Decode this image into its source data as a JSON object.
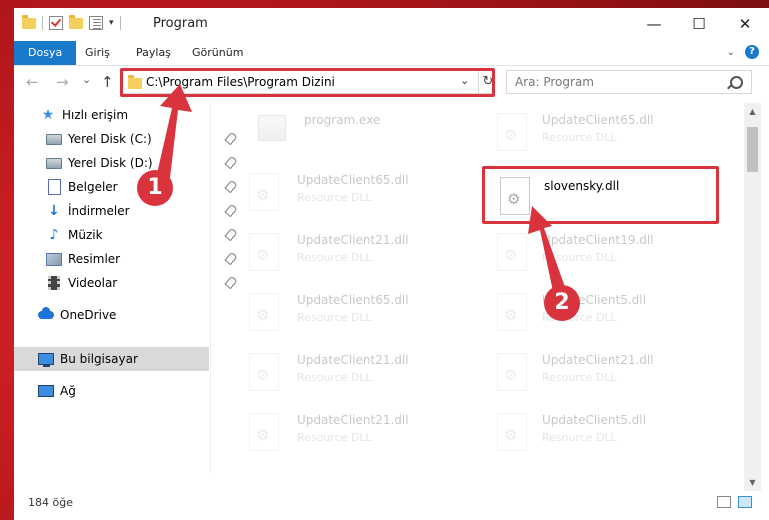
{
  "window": {
    "title": "Program",
    "minimize_glyph": "—",
    "maximize_glyph": "☐",
    "close_glyph": "✕"
  },
  "ribbon": {
    "tabs": [
      {
        "label": "Dosya"
      },
      {
        "label": "Giriş"
      },
      {
        "label": "Paylaş"
      },
      {
        "label": "Görünüm"
      }
    ]
  },
  "nav": {
    "address": "C:\\Program Files\\Program Dizini",
    "search_placeholder": "Ara: Program",
    "back_glyph": "←",
    "forward_glyph": "→",
    "recent_glyph": "⌄",
    "up_glyph": "↑",
    "refresh_glyph": "↻"
  },
  "sidebar": {
    "items": [
      {
        "label": "Hızlı erişim",
        "icon": "star-icon"
      },
      {
        "label": "Yerel Disk (C:)",
        "icon": "drive-icon"
      },
      {
        "label": "Yerel Disk (D:)",
        "icon": "drive-icon"
      },
      {
        "label": "Belgeler",
        "icon": "documents-icon"
      },
      {
        "label": "İndirmeler",
        "icon": "downloads-icon"
      },
      {
        "label": "Müzik",
        "icon": "music-icon"
      },
      {
        "label": "Resimler",
        "icon": "pictures-icon"
      },
      {
        "label": "Videolar",
        "icon": "videos-icon"
      },
      {
        "label": "OneDrive",
        "icon": "cloud-icon"
      },
      {
        "label": "Bu bilgisayar",
        "icon": "computer-icon"
      },
      {
        "label": "Ağ",
        "icon": "network-icon"
      }
    ]
  },
  "files": [
    {
      "name": "program.exe",
      "type": ""
    },
    {
      "name": "UpdateClient65.dll",
      "type": "Resource DLL"
    },
    {
      "name": "UpdateClient65.dll",
      "type": "Resource DLL"
    },
    {
      "name": "slovensky.dll",
      "type": ""
    },
    {
      "name": "UpdateClient21.dll",
      "type": "Resource DLL"
    },
    {
      "name": "UpdateClient19.dll",
      "type": "Resource DLL"
    },
    {
      "name": "UpdateClient65.dll",
      "type": "Resource DLL"
    },
    {
      "name": "UpdateClient5.dll",
      "type": "Resource DLL"
    },
    {
      "name": "UpdateClient21.dll",
      "type": "Resource DLL"
    },
    {
      "name": "UpdateClient21.dll",
      "type": "Resource DLL"
    },
    {
      "name": "UpdateClient21.dll",
      "type": "Resource DLL"
    },
    {
      "name": "UpdateClient5.dll",
      "type": "Resource DLL"
    }
  ],
  "status": {
    "item_count": "184 öğe"
  },
  "markers": [
    {
      "label": "1"
    },
    {
      "label": "2"
    }
  ],
  "colors": {
    "accent": "#1979ca",
    "highlight": "#d9343e"
  }
}
